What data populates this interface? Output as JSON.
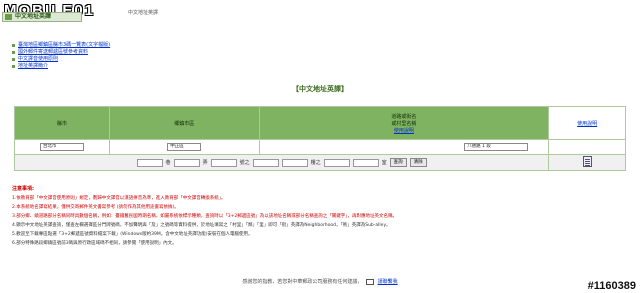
{
  "topbar": {
    "logo": "MOBILE01",
    "logo_sub": "MOBILE01",
    "title": "中文地址英譯"
  },
  "section": {
    "label": "中文地址英譯"
  },
  "links": [
    "臺灣地區鄉鎮區縣市3碼一覽表(文字檔版)",
    "國外郵件寄送郵遞區號參考資料",
    "中文譯音使用原則",
    "地址英譯簡介"
  ],
  "main_title": "【中文地址英譯】",
  "grid": {
    "col_county": "縣市",
    "col_district": "鄉鎮市區",
    "col_village_1": "道路或街名",
    "col_village_2": "或村里名稱",
    "col_village_link": "使用說明",
    "col_help": "使用說明",
    "select_county": "台北市",
    "select_district": "中正區",
    "select_road": "八德路 1 段",
    "lbl_lane": "巷",
    "lbl_alley": "弄",
    "lbl_no": "號之",
    "lbl_floor": "樓之",
    "lbl_room": "室",
    "btn_query": "查詢",
    "btn_clear": "清除"
  },
  "notes": {
    "title": "注意事項:",
    "items": [
      "1.依教育部「中文譯音使用原則」規定，劃歸中文譯音以漢語拼音為準，進入教育部「中文譯音轉換系統」。",
      "2.本系統地名譯寫結果，僅供交寄郵件英文書寫參考 (請勿作為其他用途書寫依據)。",
      "3.部分鄉、鎮道路部分名稱同時具數個名稱，例如：臺鐵舊民國時期名稱，如屬系統依標示種類，查詢時以「3+2郵遞區號」為以該地址名稱或部分名稱查詢之「關鍵字」，再對應地址英文名稱。",
      "4.顯示中文地址英譯查詢，僅查左欄選擇區分門牌號碼，不加聲明與「及」之號碼等資料提供，於地址填寫之「村里」「鄰」「里」即可「街」英譯為Neighborhood，「衖」英譯為Sub-alley。",
      "5.歡迎至下載專區點選「3+2郵遞區號資料檔案下載」(Windows版約39M，含中文地址英譯功能)安裝在個人電腦使用。",
      "6.部分特殊路段鄉鎮區號前3碼與原行政區域碼不相同，請參閱「使用說明」內文。"
    ]
  },
  "footer": {
    "text": "感謝您的指教，若您對中華郵政公司服務有任何建議，",
    "link": "請聯繫我"
  },
  "watermark": "#1160389"
}
